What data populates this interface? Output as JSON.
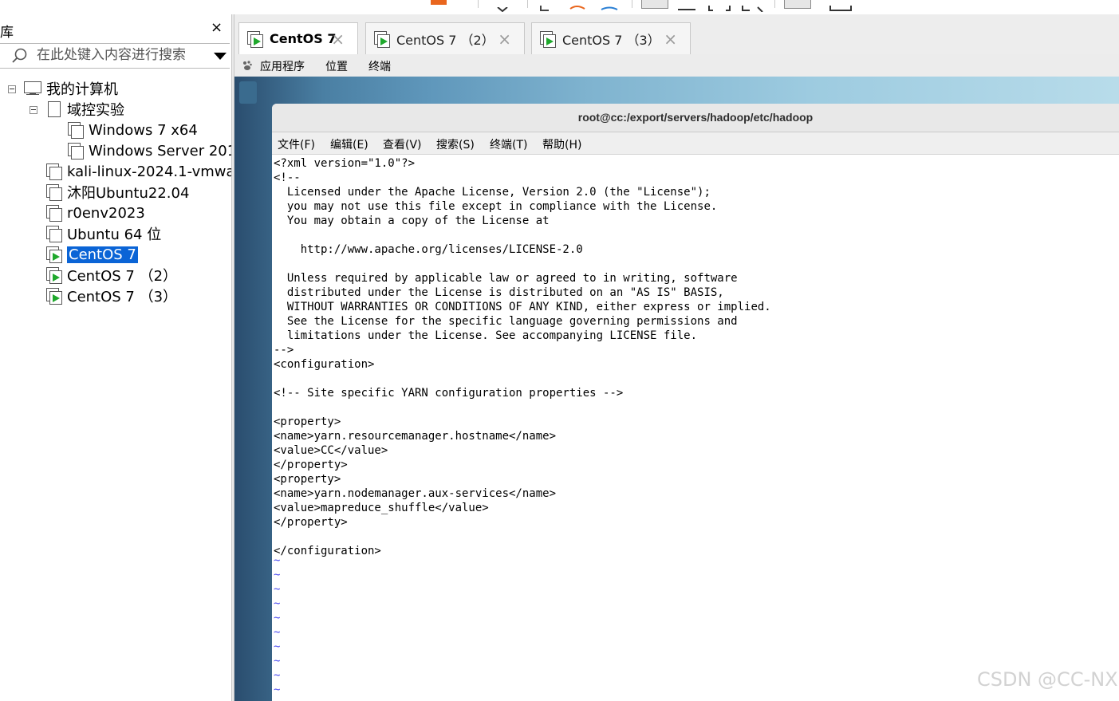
{
  "sidebar": {
    "title": "库",
    "close_glyph": "×",
    "search": {
      "placeholder": "在此处键入内容进行搜索",
      "icon": "search-icon",
      "dropdown_icon": "chevron-down-icon"
    },
    "tree": {
      "root": {
        "label": "我的计算机",
        "icon": "computer-icon",
        "expanded": true
      },
      "folder": {
        "label": "域控实验",
        "icon": "folder-icon",
        "expanded": true
      },
      "items": [
        {
          "label": "Windows 7 x64",
          "icon": "vm-icon",
          "running": false,
          "selected": false
        },
        {
          "label": "Windows Server 201",
          "icon": "vm-icon",
          "running": false,
          "selected": false
        },
        {
          "label": "kali-linux-2024.1-vmwa",
          "icon": "vm-icon",
          "running": false,
          "selected": false
        },
        {
          "label": "沐阳Ubuntu22.04",
          "icon": "vm-icon",
          "running": false,
          "selected": false
        },
        {
          "label": "r0env2023",
          "icon": "vm-icon",
          "running": false,
          "selected": false
        },
        {
          "label": "Ubuntu 64 位",
          "icon": "vm-icon",
          "running": false,
          "selected": false
        },
        {
          "label": "CentOS 7",
          "icon": "vm-running-icon",
          "running": true,
          "selected": true
        },
        {
          "label": "CentOS 7 （2）",
          "icon": "vm-running-icon",
          "running": true,
          "selected": false
        },
        {
          "label": "CentOS 7 （3）",
          "icon": "vm-running-icon",
          "running": true,
          "selected": false
        }
      ]
    }
  },
  "tabs": [
    {
      "label": "CentOS 7",
      "active": true,
      "close_glyph": "×"
    },
    {
      "label": "CentOS 7 （2）",
      "active": false,
      "close_glyph": "×"
    },
    {
      "label": "CentOS 7 （3）",
      "active": false,
      "close_glyph": "×"
    }
  ],
  "gnome_bar": {
    "apps": "应用程序",
    "places": "位置",
    "terminal": "终端"
  },
  "terminal": {
    "title": "root@cc:/export/servers/hadoop/etc/hadoop",
    "menu": [
      "文件(F)",
      "编辑(E)",
      "查看(V)",
      "搜索(S)",
      "终端(T)",
      "帮助(H)"
    ],
    "lines": [
      "<?xml version=\"1.0\"?>",
      "<!--",
      "  Licensed under the Apache License, Version 2.0 (the \"License\");",
      "  you may not use this file except in compliance with the License.",
      "  You may obtain a copy of the License at",
      "",
      "    http://www.apache.org/licenses/LICENSE-2.0",
      "",
      "  Unless required by applicable law or agreed to in writing, software",
      "  distributed under the License is distributed on an \"AS IS\" BASIS,",
      "  WITHOUT WARRANTIES OR CONDITIONS OF ANY KIND, either express or implied.",
      "  See the License for the specific language governing permissions and",
      "  limitations under the License. See accompanying LICENSE file.",
      "-->",
      "<configuration>",
      "",
      "<!-- Site specific YARN configuration properties -->",
      "",
      "<property>",
      "<name>yarn.resourcemanager.hostname</name>",
      "<value>CC</value>",
      "</property>",
      "<property>",
      "<name>yarn.nodemanager.aux-services</name>",
      "<value>mapreduce_shuffle</value>",
      "</property>",
      "",
      "</configuration>"
    ],
    "tilde_lines": [
      "~",
      "~",
      "~",
      "~",
      "~",
      "~",
      "~",
      "~",
      "~",
      "~"
    ]
  },
  "watermark": "CSDN @CC-NX",
  "colors": {
    "selection": "#0a64d6",
    "running": "#1fa82c",
    "tilde": "#4a4af0"
  }
}
